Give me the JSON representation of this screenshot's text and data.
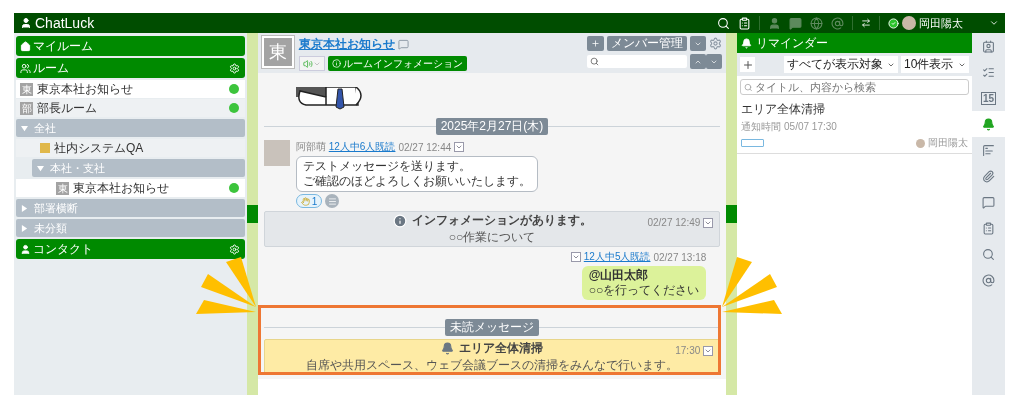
{
  "header": {
    "logo": "ChatLuck",
    "user": "岡田陽太",
    "online": true
  },
  "sidebar": {
    "myroom": "マイルーム",
    "rooms_title": "ルーム",
    "contacts_title": "コンタクト",
    "rooms": [
      {
        "badge": "東",
        "label": "東京本社お知らせ",
        "selected": true,
        "online": true
      },
      {
        "badge": "部",
        "label": "部長ルーム",
        "selected": false,
        "online": true
      }
    ],
    "groups": [
      {
        "label": "全社",
        "expanded": true,
        "children": [
          {
            "kind": "room",
            "label": "社内システムQA",
            "selected": false
          },
          {
            "kind": "group",
            "label": "本社・支社",
            "expanded": true,
            "children": [
              {
                "kind": "room",
                "badge": "東",
                "label": "東京本社お知らせ",
                "selected": true,
                "online": true
              }
            ]
          }
        ]
      },
      {
        "label": "部署横断",
        "expanded": false
      },
      {
        "label": "未分類",
        "expanded": false
      }
    ]
  },
  "room": {
    "badge": "東",
    "title": "東京本社お知らせ",
    "info_button": "ルームインフォメーション",
    "member_button": "メンバー管理",
    "sound_on": true
  },
  "messages": [
    {
      "kind": "image"
    },
    {
      "kind": "date",
      "label": "2025年2月27日(木)"
    },
    {
      "kind": "incoming",
      "author": "阿部萌",
      "read": "12人中6人既読",
      "time": "02/27 12:44",
      "lines": [
        "テストメッセージを送ります。",
        "ご確認のほどよろしくお願いいたします。"
      ],
      "reaction_count": "1"
    },
    {
      "kind": "info",
      "title": "インフォメーションがあります。",
      "subtitle": "○○作業について",
      "time": "02/27 12:49"
    },
    {
      "kind": "outgoing",
      "read": "12人中5人既読",
      "time": "02/27 13:18",
      "mention": "@山田太郎",
      "lines": [
        "○○を行ってください"
      ]
    },
    {
      "kind": "unread",
      "label": "未読メッセージ"
    },
    {
      "kind": "reminder",
      "title": "エリア全体清掃",
      "time": "17:30",
      "text": "自席や共用スペース、ウェブ会議ブースの清掃をみんなで行います。"
    }
  ],
  "reminders": {
    "title": "リマインダー",
    "filter": "すべてが表示対象",
    "count": "10件表示",
    "placeholder": "タイトル、内容から検索",
    "items": [
      {
        "title": "エリア全体清掃",
        "notify": "通知時間 05/07 17:30",
        "owner": "岡田陽太"
      }
    ]
  },
  "side_tools": [
    {
      "kind": "contacts",
      "selected": false
    },
    {
      "kind": "tasks",
      "selected": false
    },
    {
      "kind": "calendar",
      "label": "15",
      "selected": false
    },
    {
      "kind": "reminder",
      "selected": true
    },
    {
      "kind": "gantt",
      "selected": false
    },
    {
      "kind": "files",
      "selected": false
    },
    {
      "kind": "chat",
      "selected": false
    },
    {
      "kind": "clipboard",
      "selected": false
    },
    {
      "kind": "search",
      "selected": false
    },
    {
      "kind": "mention",
      "selected": false
    }
  ]
}
